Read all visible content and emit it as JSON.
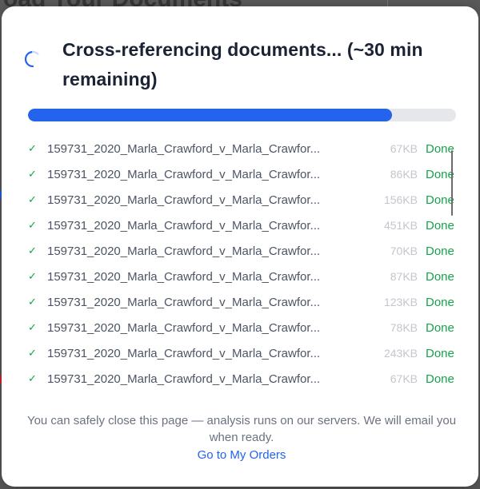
{
  "background": {
    "title": "oad Your Documents"
  },
  "modal": {
    "title": "Cross-referencing documents... (~30 min remaining)",
    "spinner_icon": "spinner-icon",
    "progress": {
      "fraction": 0.85,
      "color": "#2463eb",
      "track_color": "#e5e7eb"
    },
    "files": [
      {
        "name": "159731_2020_Marla_Crawford_v_Marla_Crawfor...",
        "size": "67KB",
        "status": "Done",
        "icon": "check-icon"
      },
      {
        "name": "159731_2020_Marla_Crawford_v_Marla_Crawfor...",
        "size": "86KB",
        "status": "Done",
        "icon": "check-icon"
      },
      {
        "name": "159731_2020_Marla_Crawford_v_Marla_Crawfor...",
        "size": "156KB",
        "status": "Done",
        "icon": "check-icon"
      },
      {
        "name": "159731_2020_Marla_Crawford_v_Marla_Crawfor...",
        "size": "451KB",
        "status": "Done",
        "icon": "check-icon"
      },
      {
        "name": "159731_2020_Marla_Crawford_v_Marla_Crawfor...",
        "size": "70KB",
        "status": "Done",
        "icon": "check-icon"
      },
      {
        "name": "159731_2020_Marla_Crawford_v_Marla_Crawfor...",
        "size": "87KB",
        "status": "Done",
        "icon": "check-icon"
      },
      {
        "name": "159731_2020_Marla_Crawford_v_Marla_Crawfor...",
        "size": "123KB",
        "status": "Done",
        "icon": "check-icon"
      },
      {
        "name": "159731_2020_Marla_Crawford_v_Marla_Crawfor...",
        "size": "78KB",
        "status": "Done",
        "icon": "check-icon"
      },
      {
        "name": "159731_2020_Marla_Crawford_v_Marla_Crawfor...",
        "size": "243KB",
        "status": "Done",
        "icon": "check-icon"
      },
      {
        "name": "159731_2020_Marla_Crawford_v_Marla_Crawfor...",
        "size": "67KB",
        "status": "Done",
        "icon": "check-icon"
      }
    ],
    "check_glyph": "✓",
    "status_color": "#16a34a",
    "footer": {
      "message": "You can safely close this page — analysis runs on our servers. We will email you when ready.",
      "link_label": "Go to My Orders"
    }
  }
}
